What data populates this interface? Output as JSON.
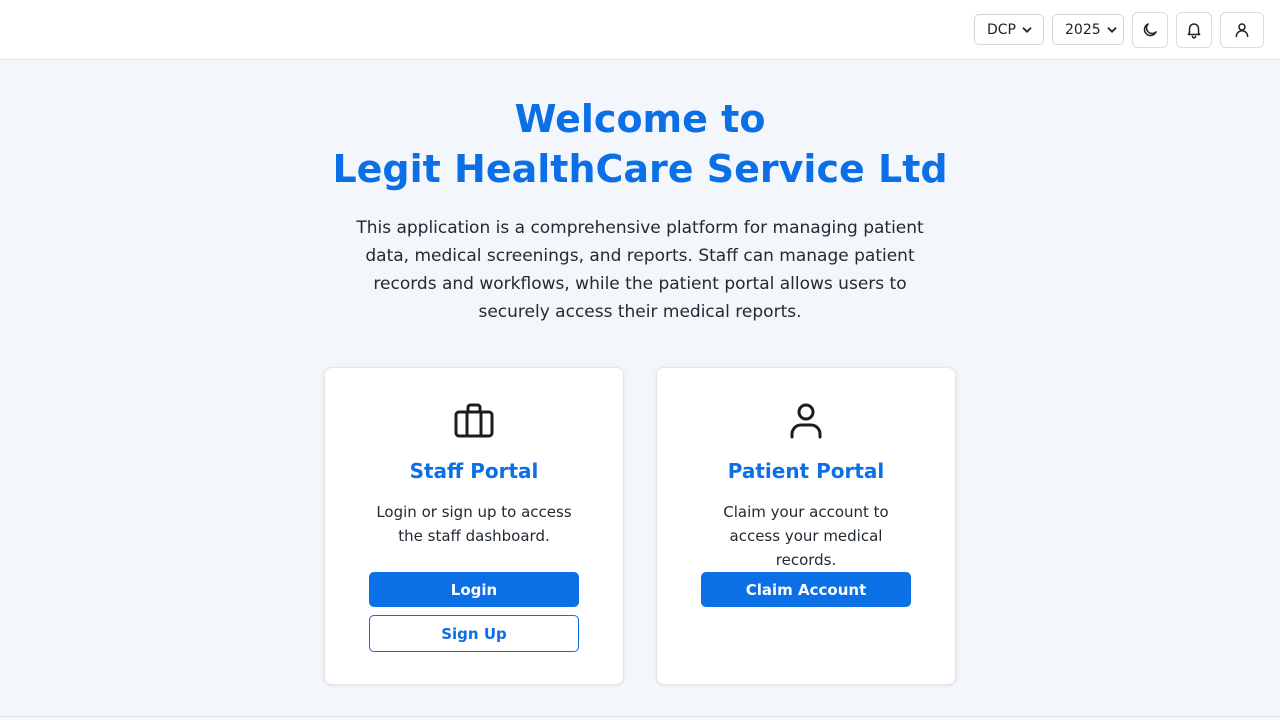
{
  "header": {
    "org_select": {
      "value": "DCP",
      "options": [
        "DCP"
      ]
    },
    "year_select": {
      "value": "2025",
      "options": [
        "2025"
      ]
    },
    "icons": {
      "theme": "moon-icon",
      "notifications": "bell-icon",
      "profile": "user-icon"
    }
  },
  "hero": {
    "title_line1": "Welcome to",
    "title_line2": "Legit HealthCare Service Ltd",
    "description": "This application is a comprehensive platform for managing patient data, medical screenings, and reports. Staff can manage patient records and workflows, while the patient portal allows users to securely access their medical reports."
  },
  "cards": {
    "staff": {
      "icon": "briefcase-icon",
      "title": "Staff Portal",
      "description": "Login or sign up to access the staff dashboard.",
      "login_label": "Login",
      "signup_label": "Sign Up"
    },
    "patient": {
      "icon": "user-icon",
      "title": "Patient Portal",
      "description": "Claim your account to access your medical records.",
      "claim_label": "Claim Account"
    }
  },
  "colors": {
    "accent": "#0b6fe6",
    "background": "#f3f6fa",
    "card": "#ffffff"
  }
}
